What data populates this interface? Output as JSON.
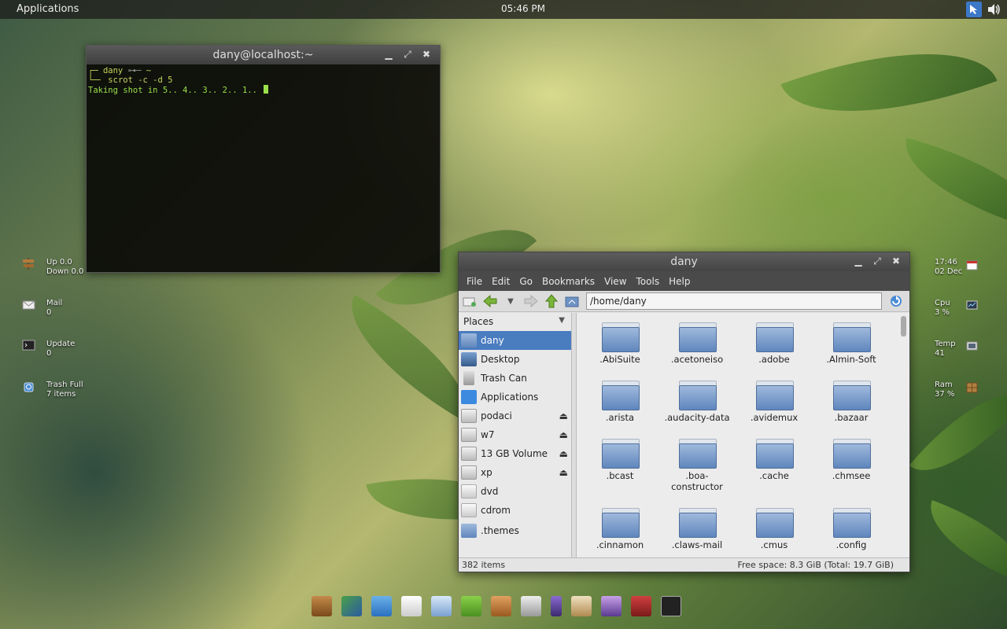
{
  "top_panel": {
    "applications_label": "Applications",
    "clock": "05:46 PM",
    "tray_icons": [
      "cursor-icon",
      "volume-icon"
    ]
  },
  "terminal": {
    "title": "dany@localhost:~",
    "prompt_user": "dany",
    "prompt_path": "~",
    "command": "scrot -c -d 5",
    "output": "Taking shot in 5.. 4.. 3.. 2.. 1.."
  },
  "desktop_widgets_left": [
    {
      "label": "Up 0.0",
      "value": "Down 0.0",
      "icon": "signpost-icon"
    },
    {
      "label": "Mail",
      "value": "0",
      "icon": "mail-icon"
    },
    {
      "label": "Update",
      "value": "0",
      "icon": "terminal-icon"
    },
    {
      "label": "Trash Full",
      "value": "7 items",
      "icon": "trash-icon"
    }
  ],
  "desktop_widgets_right": [
    {
      "label": "17:46",
      "value": "02 Dec",
      "icon": "calendar-icon"
    },
    {
      "label": "Cpu",
      "value": "3 %",
      "icon": "monitor-graph-icon"
    },
    {
      "label": "Temp",
      "value": "41",
      "icon": "monitor-icon"
    },
    {
      "label": "Ram",
      "value": "37 %",
      "icon": "ram-icon"
    }
  ],
  "file_manager": {
    "title": "dany",
    "menu": [
      "File",
      "Edit",
      "Go",
      "Bookmarks",
      "View",
      "Tools",
      "Help"
    ],
    "path": "/home/dany",
    "places_header": "Places",
    "places": [
      {
        "label": "dany",
        "selected": true,
        "eject": false
      },
      {
        "label": "Desktop",
        "eject": false
      },
      {
        "label": "Trash Can",
        "eject": false
      },
      {
        "label": "Applications",
        "eject": false
      },
      {
        "label": "podaci",
        "eject": true
      },
      {
        "label": "w7",
        "eject": true
      },
      {
        "label": "13 GB Volume",
        "eject": true
      },
      {
        "label": "xp",
        "eject": true
      },
      {
        "label": "dvd",
        "eject": false
      },
      {
        "label": "cdrom",
        "eject": false
      },
      {
        "label": ".themes",
        "eject": false
      }
    ],
    "folders": [
      ".AbiSuite",
      ".acetoneiso",
      ".adobe",
      ".Almin-Soft",
      ".arista",
      ".audacity-data",
      ".avidemux",
      ".bazaar",
      ".bcast",
      ".boa-constructor",
      ".cache",
      ".chmsee",
      ".cinnamon",
      ".claws-mail",
      ".cmus",
      ".config"
    ],
    "status_count": "382 items",
    "status_free": "Free space: 8.3 GiB (Total: 19.7 GiB)"
  },
  "dock": [
    "signpost-icon",
    "image-viewer-icon",
    "video-chat-icon",
    "text-editor-icon",
    "spreadsheet-icon",
    "chat-icon",
    "files-cabinet-icon",
    "gamepad-icon",
    "settings-icon",
    "clipboard-icon",
    "display-icon",
    "book-icon",
    "terminal-icon"
  ]
}
